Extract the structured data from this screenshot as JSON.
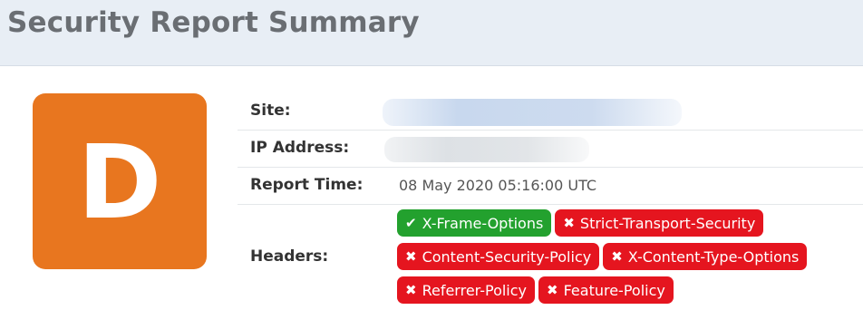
{
  "header": {
    "title": "Security Report Summary",
    "background": "#e8eef5"
  },
  "grade": {
    "letter": "D",
    "color": "#e8761f"
  },
  "details": {
    "site_label": "Site:",
    "site_value": "",
    "ip_label": "IP Address:",
    "ip_value": "",
    "report_time_label": "Report Time:",
    "report_time_value": "08 May 2020 05:16:00 UTC",
    "headers_label": "Headers:"
  },
  "headers": [
    [
      {
        "name": "X-Frame-Options",
        "status": "pass",
        "icon": "checkmark-icon"
      },
      {
        "name": "Strict-Transport-Security",
        "status": "fail",
        "icon": "x-icon"
      }
    ],
    [
      {
        "name": "Content-Security-Policy",
        "status": "fail",
        "icon": "x-icon"
      },
      {
        "name": "X-Content-Type-Options",
        "status": "fail",
        "icon": "x-icon"
      }
    ],
    [
      {
        "name": "Referrer-Policy",
        "status": "fail",
        "icon": "x-icon"
      },
      {
        "name": "Feature-Policy",
        "status": "fail",
        "icon": "x-icon"
      }
    ]
  ],
  "colors": {
    "pass": "#23a12e",
    "fail": "#e5151f"
  }
}
